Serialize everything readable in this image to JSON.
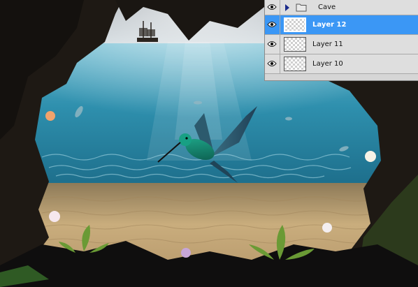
{
  "layers_panel": {
    "group": {
      "label": "Cave",
      "icon": "folder-icon",
      "visible": true,
      "expanded": false
    },
    "layers": [
      {
        "label": "Layer 12",
        "visible": true,
        "selected": true
      },
      {
        "label": "Layer 11",
        "visible": true,
        "selected": false
      },
      {
        "label": "Layer 10",
        "visible": true,
        "selected": false
      }
    ]
  },
  "colors": {
    "selection": "#3b97f5",
    "panel": "#d6d6d6"
  }
}
